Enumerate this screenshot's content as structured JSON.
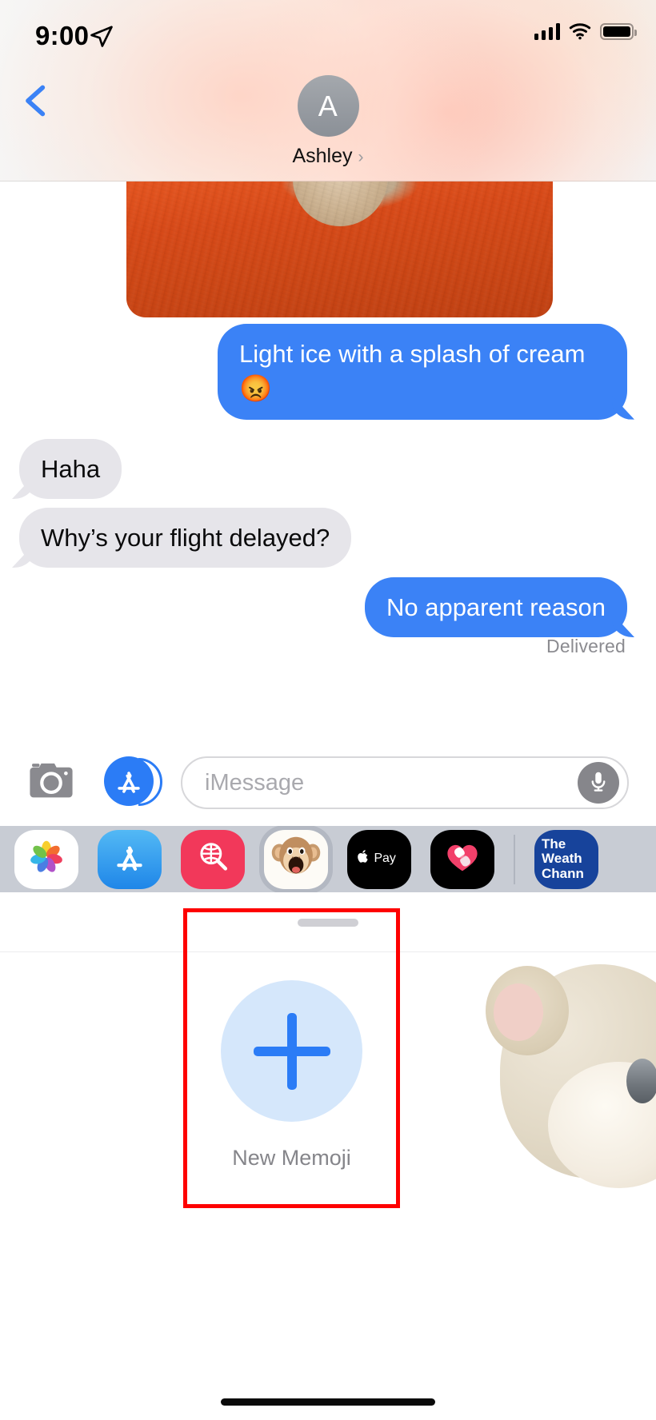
{
  "status_bar": {
    "time": "9:00",
    "location_icon": "location-arrow-icon",
    "signal_icon": "cellular-signal-icon",
    "wifi_icon": "wifi-icon",
    "battery_icon": "battery-full-icon"
  },
  "nav": {
    "back_icon": "chevron-left-icon",
    "avatar_initial": "A",
    "contact_name": "Ashley",
    "contact_chevron": "›"
  },
  "thread": {
    "messages": [
      {
        "id": "photo",
        "sender": "me",
        "type": "photo",
        "text": ""
      },
      {
        "id": "light",
        "sender": "me",
        "type": "text",
        "text": "Light ice with a splash of cream",
        "emoji": "😡"
      },
      {
        "id": "haha",
        "sender": "them",
        "type": "text",
        "text": "Haha"
      },
      {
        "id": "why",
        "sender": "them",
        "type": "text",
        "text": "Why’s your flight delayed?"
      },
      {
        "id": "noreason",
        "sender": "me",
        "type": "text",
        "text": "No apparent reason"
      }
    ],
    "delivery_status": "Delivered",
    "bubble_color_me": "#3b82f6",
    "bubble_color_them": "#e6e5ea"
  },
  "input_bar": {
    "camera_icon": "camera-icon",
    "appstore_icon": "app-store-icon",
    "placeholder": "iMessage",
    "value": "",
    "mic_icon": "microphone-icon"
  },
  "app_drawer": {
    "apps": [
      {
        "name": "photos",
        "icon": "photos-icon",
        "label": "",
        "selected": false
      },
      {
        "name": "app-store",
        "icon": "app-store-icon",
        "label": "",
        "selected": false
      },
      {
        "name": "images",
        "icon": "images-search-icon",
        "label": "",
        "selected": false
      },
      {
        "name": "memoji",
        "icon": "memoji-monkey-icon",
        "label": "",
        "selected": true
      },
      {
        "name": "apple-pay",
        "icon": "apple-pay-icon",
        "label": "Pay",
        "selected": false
      },
      {
        "name": "activity",
        "icon": "activity-heart-icon",
        "label": "",
        "selected": false
      },
      {
        "name": "weather-channel",
        "icon": "weather-channel-icon",
        "label": "The Weather Channel",
        "selected": false
      }
    ],
    "weather_lines": [
      "The",
      "Weath",
      "Chann"
    ],
    "background": "#c8ccd4"
  },
  "memoji_sheet": {
    "grabber": "drag-handle",
    "new_memoji_label": "New Memoji",
    "plus_icon": "plus-icon",
    "highlight_color": "#fe0000",
    "plus_circle_color": "#d5e7fb",
    "plus_stroke_color": "#2b7cf6"
  },
  "home_indicator": "home-indicator"
}
